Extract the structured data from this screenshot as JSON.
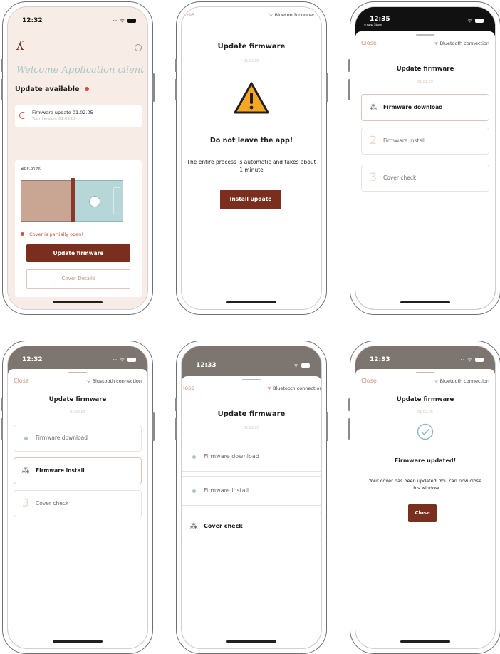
{
  "common": {
    "close_link": "Close",
    "bluetooth_label": "Bluetooth connection",
    "update_firmware_title": "Update firmware",
    "version": "01.02.05",
    "step_download": "Firmware download",
    "step_install": "Firmware install",
    "step_cover": "Cover check",
    "step2_number": "2",
    "step3_number": "3"
  },
  "screen1": {
    "time": "12:32",
    "logo": "ʎ",
    "welcome": "Welcome Application client",
    "update_available": "Update available",
    "fw_update": "Firmware update 01.02.05",
    "your_version": "Your version: 01.02.00",
    "device_id": "#RE-9176",
    "cover_status": "Cover is partially open!",
    "btn_update": "Update firmware",
    "btn_details": "Cover Details"
  },
  "screen2": {
    "close_partial": "ose",
    "bt_partial": "Bluetooth connectio",
    "warning_title": "Do not leave the app!",
    "warning_text": "The entire process is automatic and takes about 1 minute",
    "btn_install": "Install update"
  },
  "screen3": {
    "time": "12:35",
    "back_label": "◂ App Store"
  },
  "screen4": {
    "time": "12:32"
  },
  "screen5": {
    "time": "12:33",
    "close_partial": "lose",
    "bt_partial": "Bluetooth connectior"
  },
  "screen6": {
    "time": "12:33",
    "success_title": "Firmware updated!",
    "success_text": "Your cover has been updated. You can now close this window",
    "btn_close": "Close"
  },
  "icons": {
    "signal": "signal-icon",
    "wifi": "wifi-icon",
    "battery": "battery-icon",
    "warning": "warning-triangle-icon",
    "spinner": "spinner-icon",
    "check": "check-circle-icon"
  },
  "colors": {
    "brand": "#7a2f1e",
    "accent_light": "#c7937f",
    "cream_bg": "#f7ece6",
    "warning": "#f5a623",
    "teal": "#a9c6c4",
    "alert_red": "#e04b3a"
  }
}
